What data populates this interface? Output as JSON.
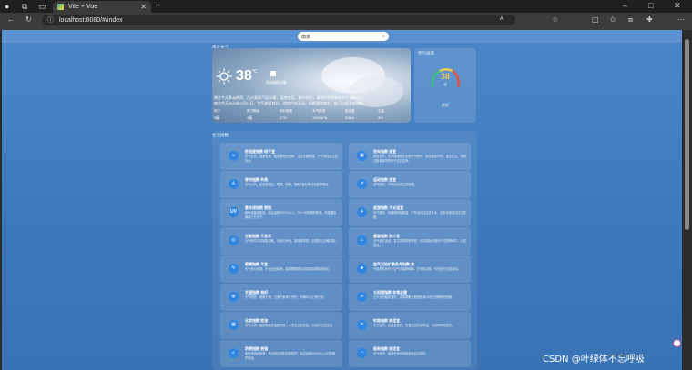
{
  "browser": {
    "tab_title": "Vite + Vue",
    "url": "localhost:8080/#/index"
  },
  "search": {
    "value": "南京"
  },
  "weather": {
    "section_label": "南京天气",
    "temperature": "38",
    "unit": "℃",
    "condition": "风向级别4级",
    "description_line1": "南京今天多云转阴，白天最高气温38度，湿度较低，紫外线强，请做好防晒措施并注意补水。",
    "description_line2": "南京今天2024年7月21日，空气质量良好，适宜户外活动，早晚温差较大，出门注意添加衣物。",
    "stats": [
      {
        "key": "风力",
        "value": "3级"
      },
      {
        "key": "风力等级",
        "value": "4级"
      },
      {
        "key": "相对湿度",
        "value": "27%"
      },
      {
        "key": "大气压强",
        "value": "1000hPa"
      },
      {
        "key": "能见度",
        "value": "30km"
      },
      {
        "key": "云量",
        "value": "3%"
      }
    ]
  },
  "air_quality": {
    "section_label": "空气质量",
    "value": "38",
    "level": "优",
    "footer": "良好",
    "fraction": 0.19,
    "colors": {
      "good": "#3cc47c",
      "moderate": "#f2c94c",
      "bad": "#e0543f"
    }
  },
  "tips": {
    "section_label": "生活指数",
    "items": [
      {
        "icon": "☺",
        "title": "舒适度指数 较不宜",
        "desc": "天气炎热，湿度较低，建议着短衣短裤，注意防暑降温，户外活动请注意补水。"
      },
      {
        "icon": "▣",
        "title": "洗车指数 适宜",
        "desc": "适宜洗车，未来持续两天无雨天气较好，适合擦洗汽车，蓝天白云、风和日丽将伴您的车子连日洁净。"
      },
      {
        "icon": "♙",
        "title": "穿衣指数 炎热",
        "desc": "天气炎热，建议着短衫、短裙、短裤、薄型T恤衫等清凉夏季服装。"
      },
      {
        "icon": "↗",
        "title": "运动指数 适宜",
        "desc": "天气较好，户外运动请注意防晒。"
      },
      {
        "icon": "UV",
        "title": "紫外线指数 很强",
        "desc": "紫外线辐射极强，建议涂擦SPF20以上、PA++的防晒护肤品，尽量避免暴露于日光下。"
      },
      {
        "icon": "✈",
        "title": "旅游指数 不太适宜",
        "desc": "天气很热，请做好防暑降温，户外活动请注意补水，如外出旅游请注意防晒。"
      },
      {
        "icon": "◎",
        "title": "过敏指数 不易发",
        "desc": "天气条件不易诱发过敏，可放心外出，除特殊体质，无需担心过敏问题。"
      },
      {
        "icon": "♨",
        "title": "感冒指数 较少发",
        "desc": "天气条件适宜，发生感冒机率较低，但请避免长期处于空调房间中，以防感冒。"
      },
      {
        "icon": "✎",
        "title": "晾晒指数 不宜",
        "desc": "天气多云转阴，不太适宜晾晒，若需要晾晒请尽量选择通风的地方。"
      },
      {
        "icon": "♣",
        "title": "空气污染扩散条件指数 良",
        "desc": "气象条件有利于空气污染物稀释、扩散和清除，可在室外正常活动。"
      },
      {
        "icon": "◍",
        "title": "交通指数 良好",
        "desc": "天气较好，路面干燥，交通气象条件良好，车辆可以正常行驶。"
      },
      {
        "icon": "∞",
        "title": "太阳镜指数 非常必要",
        "desc": "白天太阳辐射强烈，选择佩戴太阳镜能减少阳光对眼睛的伤害。"
      },
      {
        "icon": "▦",
        "title": "化妆指数 控油",
        "desc": "天气炎热，建议用露质面霜打底，水质无油粉底霜，化妆时注意控油。"
      },
      {
        "icon": "♒",
        "title": "钓鱼指数 较适宜",
        "desc": "天气较热，较适宜垂钓，但要注意防暑降温，可选择早晚垂钓。"
      },
      {
        "icon": "◐",
        "title": "防晒指数 很强",
        "desc": "紫外线辐射极强，外出时应特别加强防护，建议涂擦SPF20以上的防晒护肤品。"
      },
      {
        "icon": "◔",
        "title": "逛街指数 较适宜",
        "desc": "天气较热，选择在室内商场闲逛会比较好。"
      }
    ]
  },
  "watermark": "CSDN @叶绿体不忘呼吸"
}
